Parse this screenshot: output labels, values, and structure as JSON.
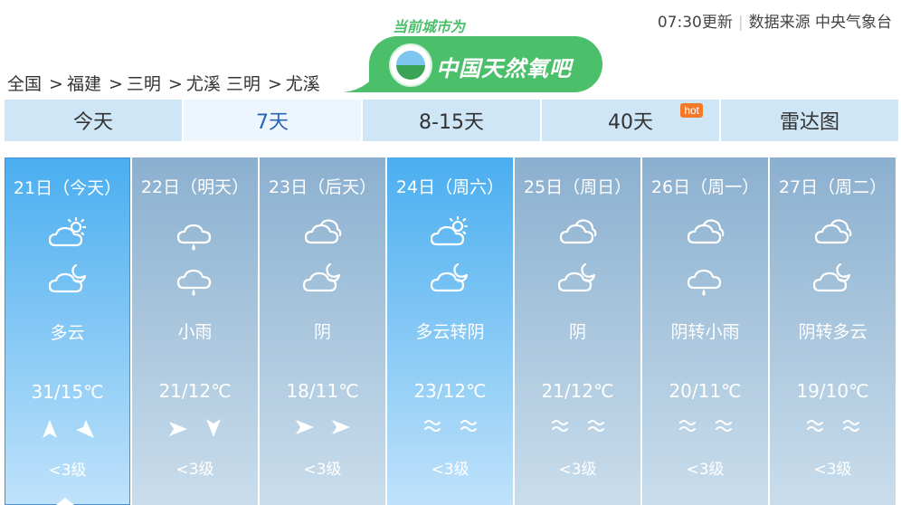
{
  "header": {
    "update_time": "07:30更新",
    "source": "数据来源 中央气象台",
    "breadcrumb": [
      "全国",
      "福建",
      "三明",
      "尤溪 三明",
      "尤溪"
    ]
  },
  "banner": {
    "slogan": "当前城市为",
    "brand": "中国天然氧吧",
    "hot_badge": "hot"
  },
  "tabs": [
    "今天",
    "7天",
    "8-15天",
    "40天",
    "雷达图"
  ],
  "active_tab": "7天",
  "days": [
    {
      "date": "21日（今天）",
      "icon_day": "sunny-cloudy-icon",
      "icon_night": "cloudy-night-icon",
      "desc": "多云",
      "temp": "31/15℃",
      "wind_day": "north-arrow-icon",
      "wind_night": "southwest-arrow-icon",
      "level": "<3级",
      "theme": "blue"
    },
    {
      "date": "22日（明天）",
      "icon_day": "light-rain-icon",
      "icon_night": "light-rain-icon",
      "desc": "小雨",
      "temp": "21/12℃",
      "wind_day": "east-arrow-icon",
      "wind_night": "south-arrow-icon",
      "level": "<3级",
      "theme": "grey"
    },
    {
      "date": "23日（后天）",
      "icon_day": "overcast-icon",
      "icon_night": "cloudy-night-icon",
      "desc": "阴",
      "temp": "18/11℃",
      "wind_day": "east-arrow-icon",
      "wind_night": "east-arrow-icon",
      "level": "<3级",
      "theme": "grey"
    },
    {
      "date": "24日（周六）",
      "icon_day": "sunny-cloudy-icon",
      "icon_night": "cloudy-night-icon",
      "desc": "多云转阴",
      "temp": "23/12℃",
      "wind_day": "variable-wind-icon",
      "wind_night": "variable-wind-icon",
      "level": "<3级",
      "theme": "blue"
    },
    {
      "date": "25日（周日）",
      "icon_day": "overcast-icon",
      "icon_night": "cloudy-night-icon",
      "desc": "阴",
      "temp": "21/12℃",
      "wind_day": "variable-wind-icon",
      "wind_night": "variable-wind-icon",
      "level": "<3级",
      "theme": "grey"
    },
    {
      "date": "26日（周一）",
      "icon_day": "overcast-icon",
      "icon_night": "light-rain-icon",
      "desc": "阴转小雨",
      "temp": "20/11℃",
      "wind_day": "variable-wind-icon",
      "wind_night": "variable-wind-icon",
      "level": "<3级",
      "theme": "grey"
    },
    {
      "date": "27日（周二）",
      "icon_day": "overcast-icon",
      "icon_night": "cloudy-night-icon",
      "desc": "阴转多云",
      "temp": "19/10℃",
      "wind_day": "variable-wind-icon",
      "wind_night": "variable-wind-icon",
      "level": "<3级",
      "theme": "grey"
    }
  ]
}
